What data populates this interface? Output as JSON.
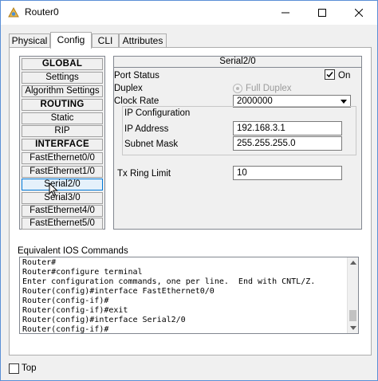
{
  "window": {
    "title": "Router0",
    "controls": [
      "minimize",
      "maximize",
      "close"
    ]
  },
  "tabs": [
    {
      "label": "Physical",
      "active": false
    },
    {
      "label": "Config",
      "active": true
    },
    {
      "label": "CLI",
      "active": false
    },
    {
      "label": "Attributes",
      "active": false
    }
  ],
  "sidebar": {
    "items": [
      {
        "label": "GLOBAL",
        "type": "header"
      },
      {
        "label": "Settings",
        "type": "item"
      },
      {
        "label": "Algorithm Settings",
        "type": "item"
      },
      {
        "label": "ROUTING",
        "type": "header"
      },
      {
        "label": "Static",
        "type": "item"
      },
      {
        "label": "RIP",
        "type": "item"
      },
      {
        "label": "INTERFACE",
        "type": "header"
      },
      {
        "label": "FastEthernet0/0",
        "type": "item"
      },
      {
        "label": "FastEthernet1/0",
        "type": "item"
      },
      {
        "label": "Serial2/0",
        "type": "item",
        "selected": true
      },
      {
        "label": "Serial3/0",
        "type": "item"
      },
      {
        "label": "FastEthernet4/0",
        "type": "item"
      },
      {
        "label": "FastEthernet5/0",
        "type": "item"
      }
    ]
  },
  "interface_panel": {
    "title": "Serial2/0",
    "port_status_label": "Port Status",
    "port_on_label": "On",
    "port_on_checked": true,
    "duplex_label": "Duplex",
    "full_duplex_label": "Full Duplex",
    "clock_rate_label": "Clock Rate",
    "clock_rate_value": "2000000",
    "ip_config_label": "IP Configuration",
    "ip_address_label": "IP Address",
    "ip_address_value": "192.168.3.1",
    "subnet_mask_label": "Subnet Mask",
    "subnet_mask_value": "255.255.255.0",
    "tx_ring_limit_label": "Tx Ring Limit",
    "tx_ring_limit_value": "10"
  },
  "ios": {
    "label": "Equivalent IOS Commands",
    "lines": [
      "Router#",
      "Router#configure terminal",
      "Enter configuration commands, one per line.  End with CNTL/Z.",
      "Router(config)#interface FastEthernet0/0",
      "Router(config-if)#",
      "Router(config-if)#exit",
      "Router(config)#interface Serial2/0",
      "Router(config-if)#"
    ]
  },
  "footer": {
    "top_label": "Top",
    "top_checked": false
  },
  "colors": {
    "accent": "#0078d7",
    "window_border": "#5a8fd6",
    "app_icon": "#e8b84a"
  },
  "icons": {
    "app": "packet-tracer-router-icon",
    "check": "checkmark-icon"
  }
}
